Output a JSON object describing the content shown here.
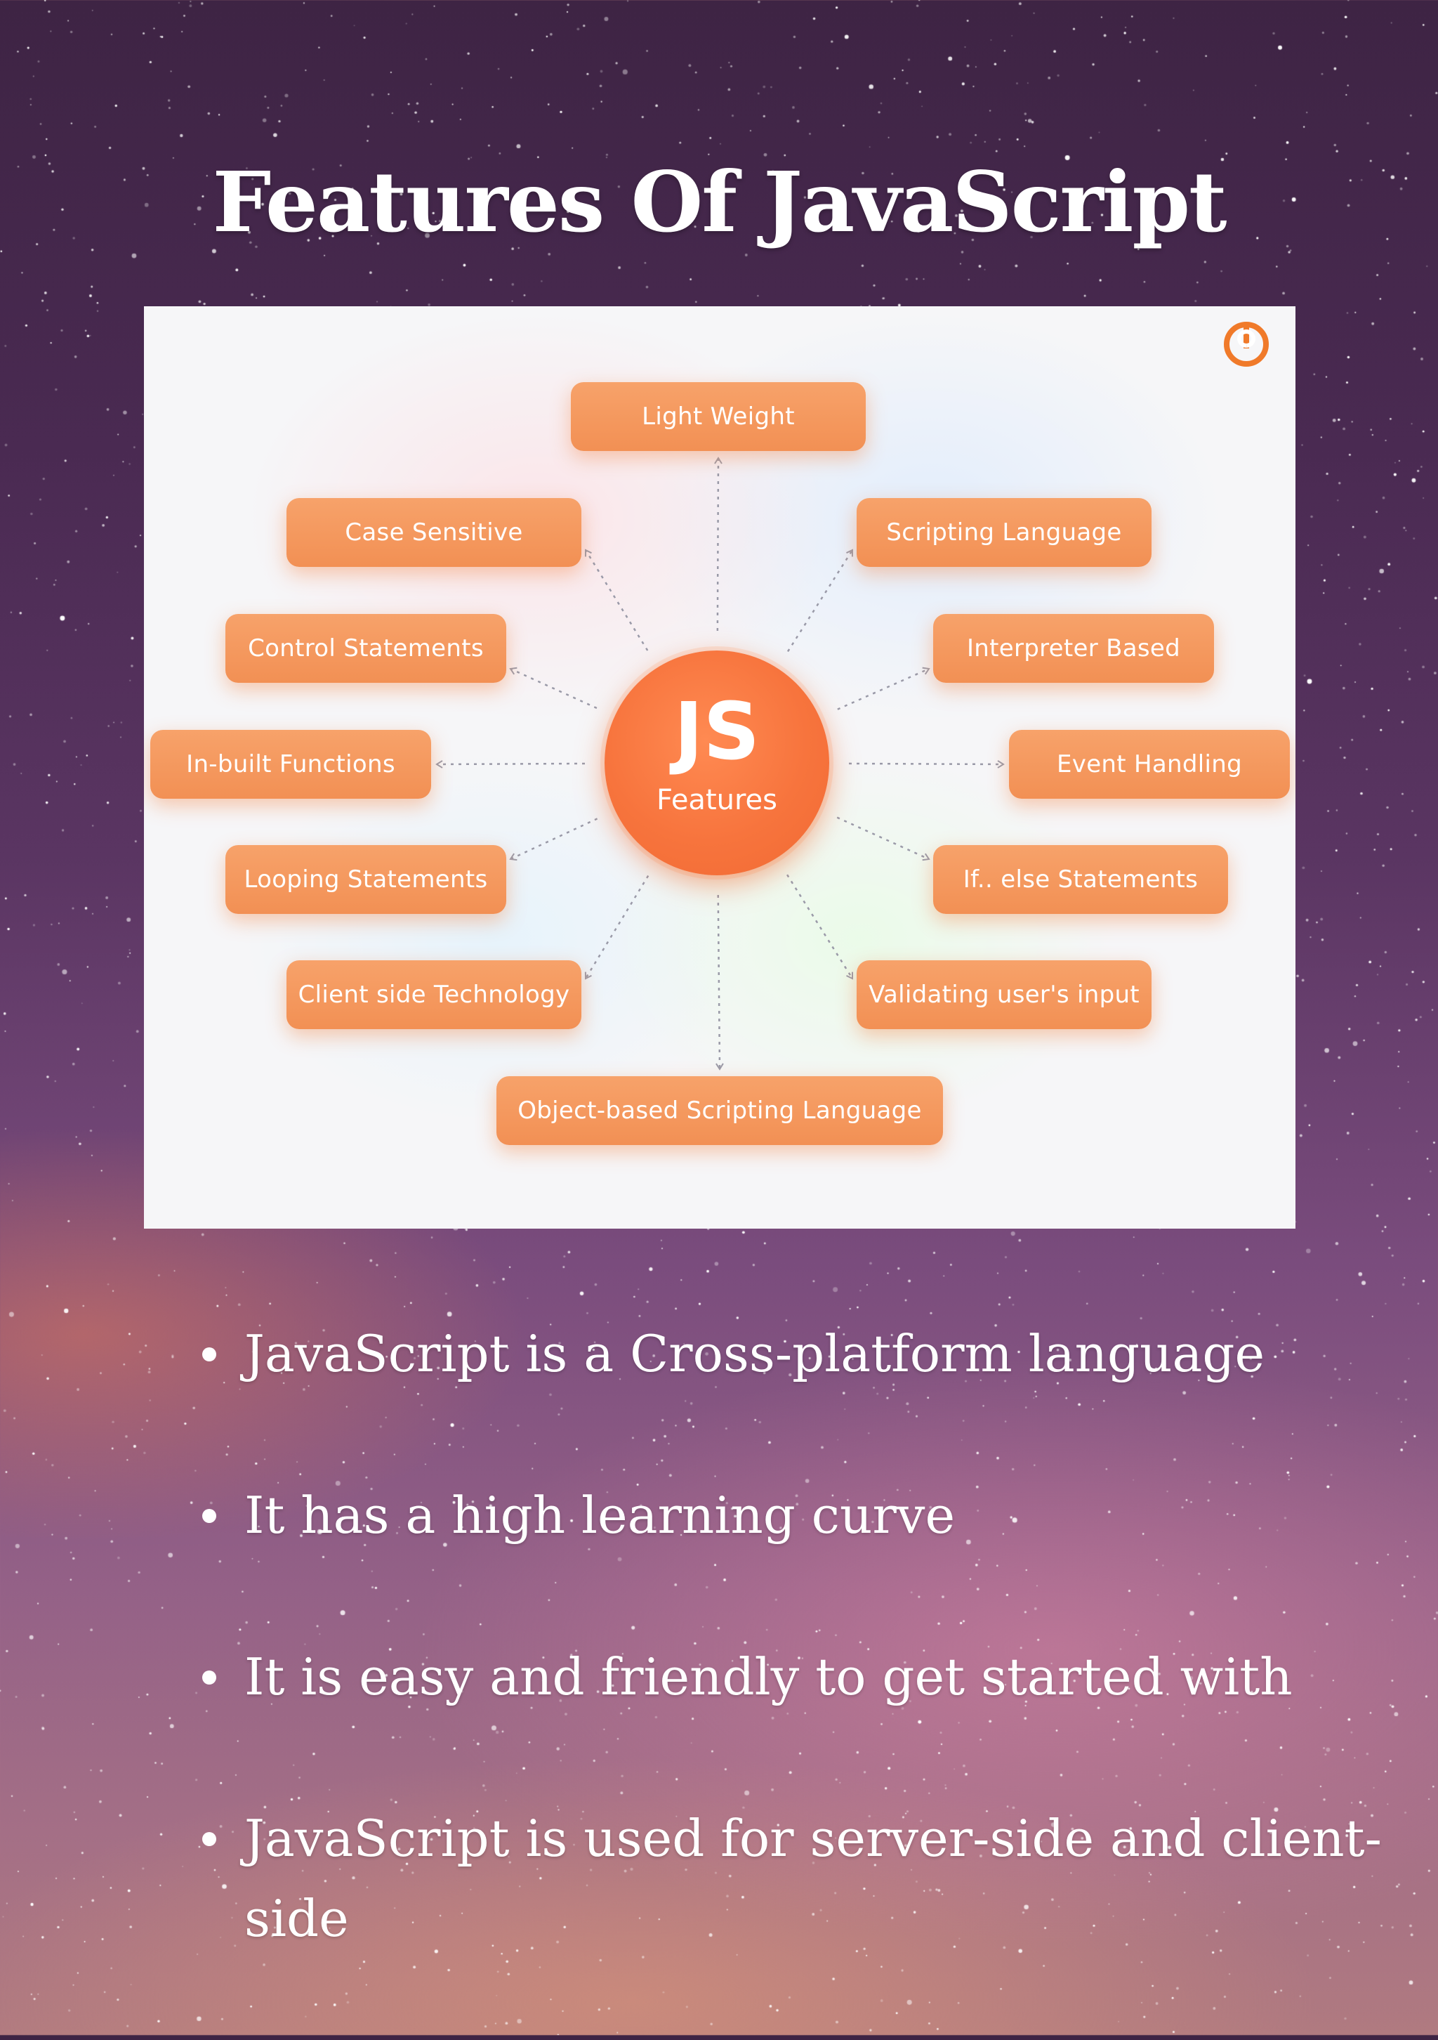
{
  "page": {
    "title": "Features Of JavaScript"
  },
  "diagram": {
    "hub": {
      "main": "JS",
      "sub": "Features"
    },
    "features": [
      "Light Weight",
      "Scripting Language",
      "Interpreter Based",
      "Event Handling",
      "If.. else Statements",
      "Validating user's input",
      "Object-based Scripting Language",
      "Client side Technology",
      "Looping Statements",
      "In-built Functions",
      "Control Statements",
      "Case Sensitive"
    ],
    "colors": {
      "pill": "#f29054",
      "hub": "#f7743d",
      "connector": "#9a9aa8",
      "logo": "#f07a2a"
    },
    "logo_icon": "brand-logo-icon"
  },
  "bullets": [
    "JavaScript is a Cross-platform language",
    "It has a high learning curve",
    "It is easy and friendly to get started with",
    "JavaScript is used for server-side and client-side"
  ]
}
